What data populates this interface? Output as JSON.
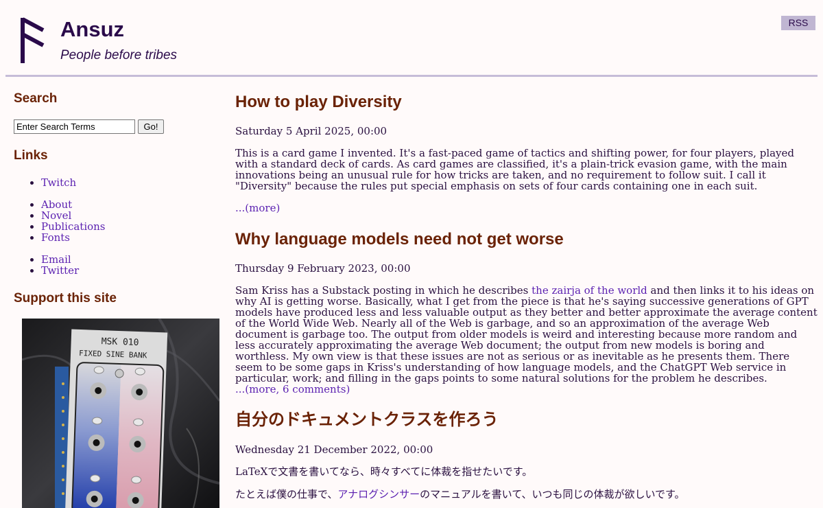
{
  "header": {
    "title": "Ansuz",
    "tagline": "People before tribes",
    "rss_label": "RSS"
  },
  "sidebar": {
    "search_heading": "Search",
    "search_placeholder": "Enter Search Terms",
    "search_button": "Go!",
    "links_heading": "Links",
    "link_groups": [
      [
        "Twitch"
      ],
      [
        "About",
        "Novel",
        "Publications",
        "Fonts"
      ],
      [
        "Email",
        "Twitter"
      ]
    ],
    "support_heading": "Support this site",
    "support_image_text": {
      "model": "MSK 010",
      "name": "FIXED SINE BANK"
    }
  },
  "posts": [
    {
      "title": "How to play Diversity",
      "date": "Saturday 5 April 2025, 00:00",
      "body": "This is a card game I invented. It's a fast-paced game of tactics and shifting power, for four players, played with a standard deck of cards. As card games are classified, it's a plain-trick evasion game, with the main innovations being an unusual rule for how tricks are taken, and no requirement to follow suit. I call it \"Diversity\" because the rules put special emphasis on sets of four cards containing one in each suit.",
      "more": "...(more)"
    },
    {
      "title": "Why language models need not get worse",
      "date": "Thursday 9 February 2023, 00:00",
      "body_before": "Sam Kriss has a Substack posting in which he describes ",
      "body_link": "the zairja of the world",
      "body_after": " and then links it to his ideas on why AI is getting worse. Basically, what I get from the piece is that he's saying successive generations of GPT models have produced less and less valuable output as they better and better approximate the average content of the World Wide Web. Nearly all of the Web is garbage, and so an approximation of the average Web document is garbage too. The output from older models is weird and interesting because more random and less accurately approximating the average Web document; the output from new models is boring and worthless. My own view is that these issues are not as serious or as inevitable as he presents them. There seem to be some gaps in Kriss's understanding of how language models, and the ChatGPT Web service in particular, work; and filling in the gaps points to some natural solutions for the problem he describes.",
      "more": "...(more, 6 comments)"
    },
    {
      "title": "自分のドキュメントクラスを作ろう",
      "date": "Wednesday 21 December 2022, 00:00",
      "para1": "LaTeXで文書を書いてなら、時々すべてに体裁を指せたいです。",
      "para2_before": "たとえば僕の仕事で、",
      "para2_link": "アナログシンサー",
      "para2_after": "のマニュアルを書いて、いつも同じの体裁が欲しいです。"
    }
  ],
  "colors": {
    "background": "#fffafa",
    "heading": "#6a2206",
    "title": "#2a0a4a",
    "link": "#5a1fb0",
    "rule": "#c6bcd8",
    "rss_bg": "#c0b6d2"
  }
}
